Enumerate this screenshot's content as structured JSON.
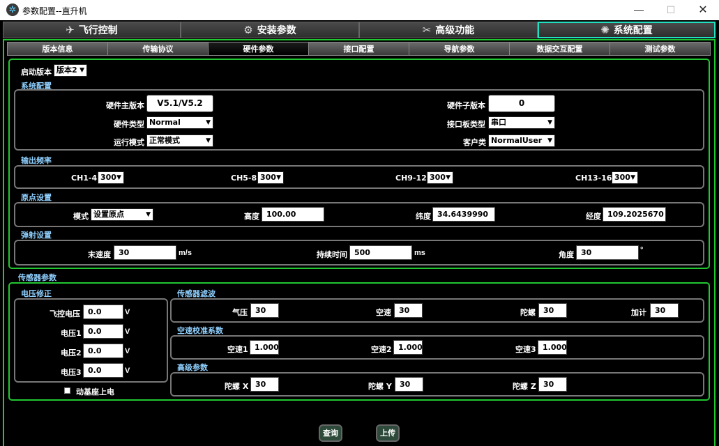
{
  "window": {
    "title": "参数配置--直升机",
    "minimize": "—",
    "maximize": "☐",
    "close": "✕"
  },
  "main_tabs": [
    {
      "label": "飞行控制",
      "icon": "drone-icon"
    },
    {
      "label": "安装参数",
      "icon": "wrench-circle-icon"
    },
    {
      "label": "高级功能",
      "icon": "tools-icon"
    },
    {
      "label": "系统配置",
      "icon": "gear-icon"
    }
  ],
  "sub_tabs": [
    "版本信息",
    "传输协议",
    "硬件参数",
    "接口配置",
    "导航参数",
    "数据交互配置",
    "测试参数"
  ],
  "active_sub_tab": "硬件参数",
  "boot": {
    "label": "启动版本",
    "value": "版本2"
  },
  "system_config": {
    "title": "系统配置",
    "hw_main_version": {
      "label": "硬件主版本",
      "value": "V5.1/V5.2"
    },
    "hw_sub_version": {
      "label": "硬件子版本",
      "value": "0"
    },
    "hw_type": {
      "label": "硬件类型",
      "value": "Normal"
    },
    "interface_board_type": {
      "label": "接口板类型",
      "value": "串口"
    },
    "run_mode": {
      "label": "运行模式",
      "value": "正常模式"
    },
    "customer_type": {
      "label": "客户类",
      "value": "NormalUser"
    }
  },
  "output_freq": {
    "title": "输出频率",
    "channels": [
      {
        "label": "CH1-4",
        "value": "300"
      },
      {
        "label": "CH5-8",
        "value": "300"
      },
      {
        "label": "CH9-12",
        "value": "300"
      },
      {
        "label": "CH13-16",
        "value": "300"
      }
    ]
  },
  "origin": {
    "title": "原点设置",
    "mode": {
      "label": "模式",
      "value": "设置原点"
    },
    "altitude": {
      "label": "高度",
      "value": "100.00"
    },
    "latitude": {
      "label": "纬度",
      "value": "34.6439990"
    },
    "longitude": {
      "label": "经度",
      "value": "109.2025670"
    }
  },
  "ejection": {
    "title": "弹射设置",
    "end_speed": {
      "label": "末速度",
      "value": "30",
      "unit": "m/s"
    },
    "duration": {
      "label": "持续时间",
      "value": "500",
      "unit": "ms"
    },
    "angle": {
      "label": "角度",
      "value": "30",
      "unit": "°"
    }
  },
  "sensor": {
    "title": "传感器参数",
    "voltage": {
      "title": "电压修正",
      "items": [
        {
          "label": "飞控电压",
          "value": "0.0",
          "unit": "V"
        },
        {
          "label": "电压1",
          "value": "0.0",
          "unit": "V"
        },
        {
          "label": "电压2",
          "value": "0.0",
          "unit": "V"
        },
        {
          "label": "电压3",
          "value": "0.0",
          "unit": "V"
        }
      ],
      "checkbox_label": "动基座上电"
    },
    "filter": {
      "title": "传感器滤波",
      "items": [
        {
          "label": "气压",
          "value": "30"
        },
        {
          "label": "空速",
          "value": "30"
        },
        {
          "label": "陀螺",
          "value": "30"
        },
        {
          "label": "加计",
          "value": "30"
        }
      ]
    },
    "airspeed_cal": {
      "title": "空速校准系数",
      "items": [
        {
          "label": "空速1",
          "value": "1.000"
        },
        {
          "label": "空速2",
          "value": "1.000"
        },
        {
          "label": "空速3",
          "value": "1.000"
        }
      ]
    },
    "advanced": {
      "title": "高级参数",
      "items": [
        {
          "label": "陀螺 X",
          "value": "30"
        },
        {
          "label": "陀螺 Y",
          "value": "30"
        },
        {
          "label": "陀螺 Z",
          "value": "30"
        }
      ]
    }
  },
  "buttons": {
    "query": "查询",
    "upload": "上传"
  }
}
